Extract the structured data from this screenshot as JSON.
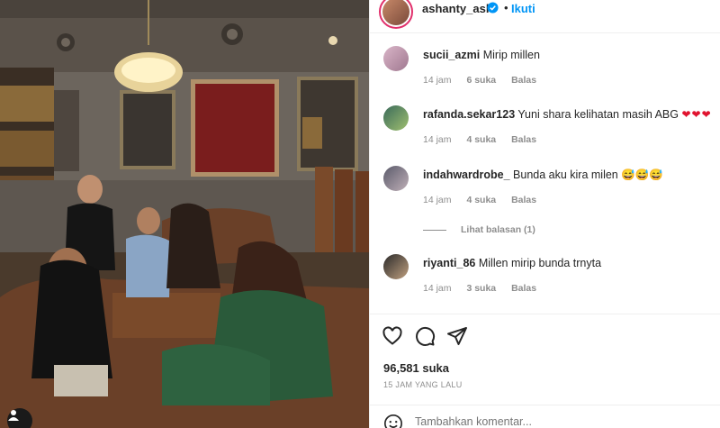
{
  "post": {
    "username": "ashanty_ash",
    "separator": "•",
    "follow_label": "Ikuti",
    "likes": "96,581 suka",
    "timestamp": "15 JAM YANG LALU",
    "comment_placeholder": "Tambahkan komentar..."
  },
  "comments": [
    {
      "user": "sucii_azmi",
      "text": "Mirip millen",
      "age": "14 jam",
      "likes": "6 suka",
      "reply": "Balas"
    },
    {
      "user": "rafanda.sekar123",
      "text": "Yuni shara kelihatan masih ABG",
      "suffix": "❤❤❤",
      "age": "14 jam",
      "likes": "4 suka",
      "reply": "Balas"
    },
    {
      "user": "indahwardrobe_",
      "text": "Bunda aku kira milen",
      "suffix": "😅😅😅",
      "age": "14 jam",
      "likes": "4 suka",
      "reply": "Balas"
    },
    {
      "user": "riyanti_86",
      "text": "Millen mirip bunda trnyta",
      "age": "14 jam",
      "likes": "3 suka",
      "reply": "Balas"
    }
  ],
  "view_replies": "Lihat balasan (1)",
  "icons": {
    "like": "heart-icon",
    "comment": "comment-icon",
    "share": "send-icon",
    "emoji": "emoji-icon",
    "verified": "verified-badge-icon",
    "tagged": "user-tag-icon"
  },
  "colors": {
    "accent": "#0095f6",
    "meta": "#8e8e8e",
    "heart": "#e0132f"
  }
}
